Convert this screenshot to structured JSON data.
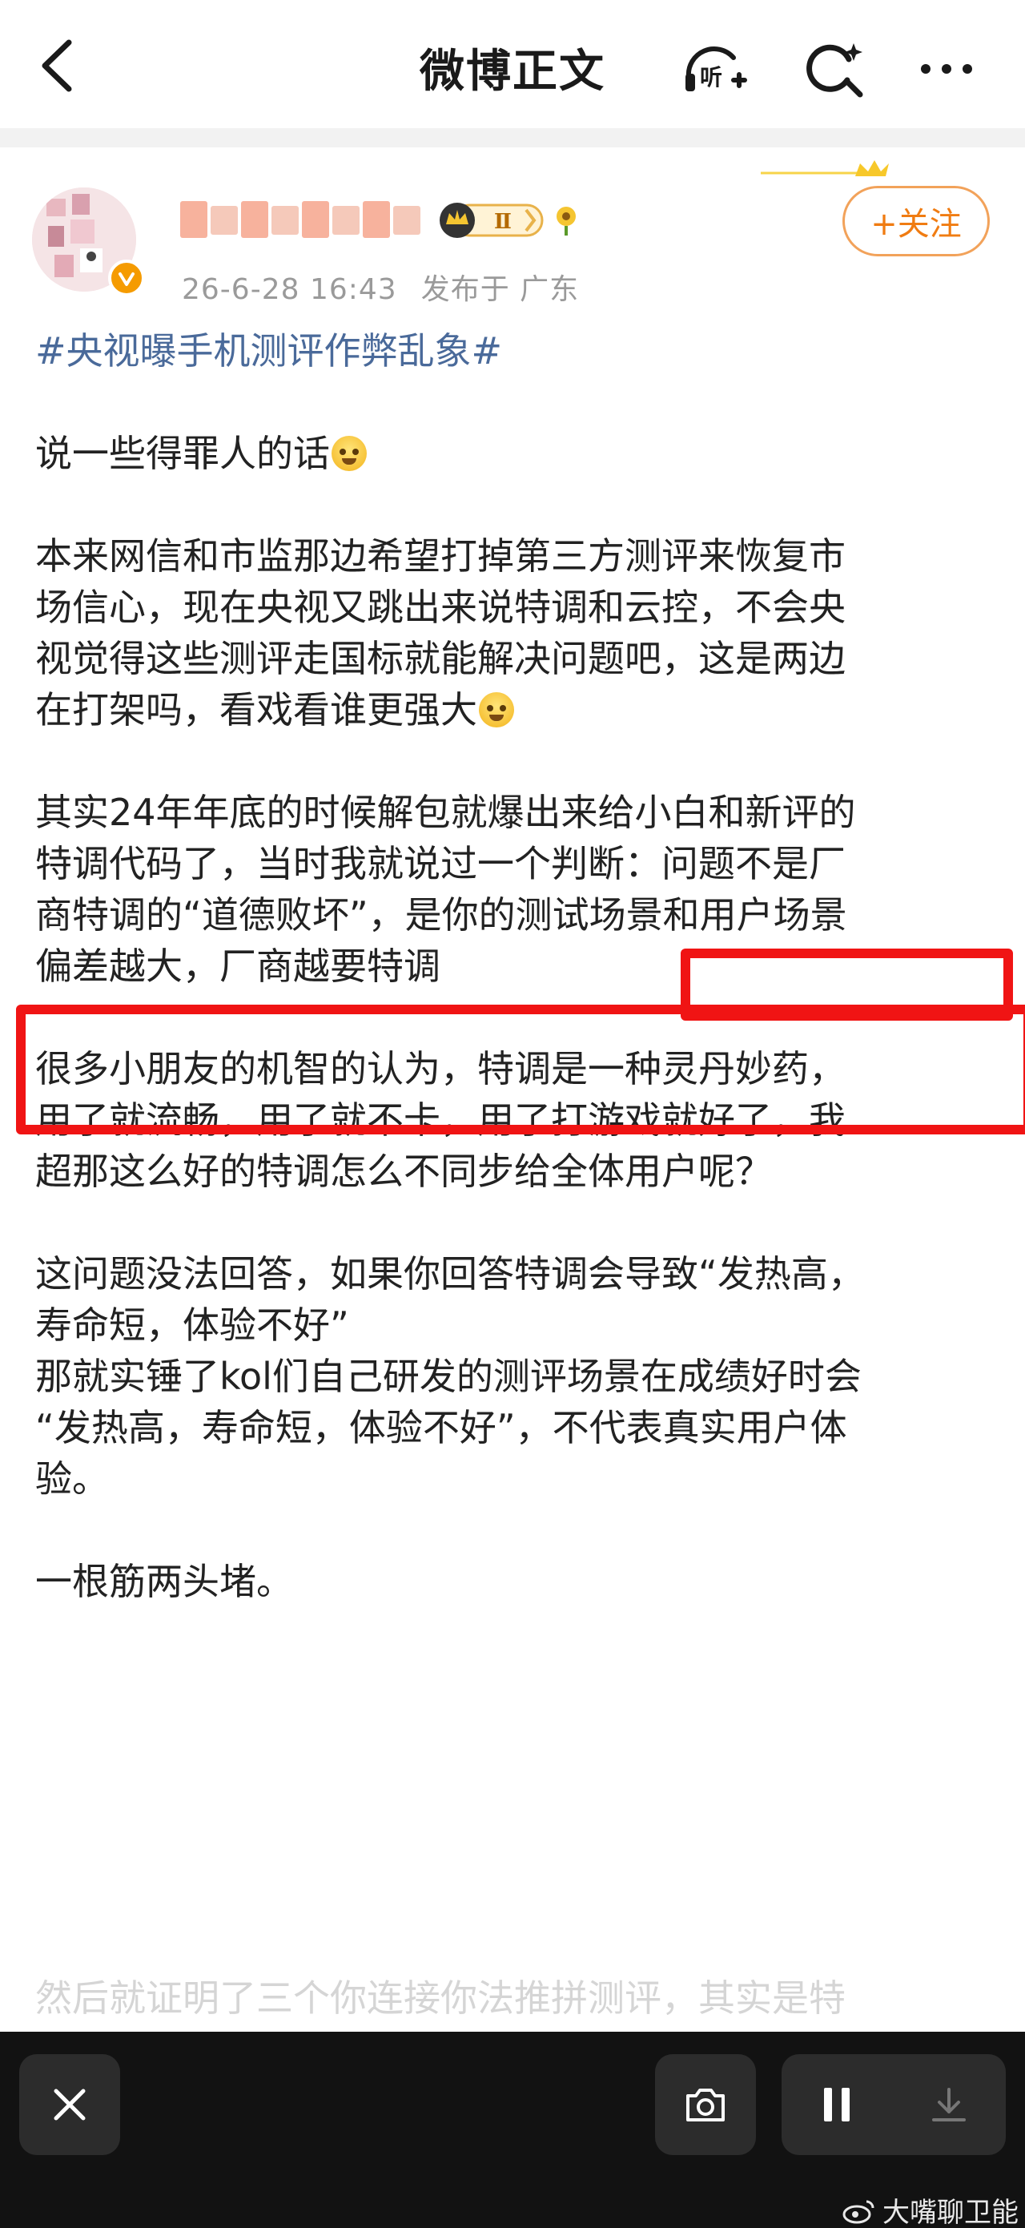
{
  "header": {
    "title": "微博正文"
  },
  "author": {
    "post_time": "26-6-28 16:43",
    "location": "发布于 广东",
    "level_badge": "Ⅱ",
    "follow_label": "+关注"
  },
  "post": {
    "hashtag": "#央视曝手机测评作弊乱象#",
    "p1": "说一些得罪人的话",
    "p2_lines": [
      "本来网信和市监那边希望打掉第三方测评来恢复市",
      "场信心，现在央视又跳出来说特调和云控，不会央",
      "视觉得这些测评走国标就能解决问题吧，这是两边",
      "在打架吗，看戏看谁更强大"
    ],
    "p3_lines": [
      "其实24年年底的时候解包就爆出来给小白和新评的",
      "特调代码了，当时我就说过一个判断：问题不是厂",
      "商特调的“道德败坏”，是你的测试场景和用户场景",
      "偏差越大，厂商越要特调"
    ],
    "p4_lines": [
      "很多小朋友的机智的认为，特调是一种灵丹妙药，",
      "用了就流畅，用了就不卡，用了打游戏就好了，我",
      "超那这么好的特调怎么不同步给全体用户呢？"
    ],
    "p5_lines": [
      "这问题没法回答，如果你回答特调会导致“发热高，",
      "寿命短，体验不好”",
      "那就实锤了kol们自己研发的测评场景在成绩好时会",
      "“发热高，寿命短，体验不好”，不代表真实用户体",
      "验。"
    ],
    "p6": "一根筋两头堵。",
    "cut_line": "然后就证明了三个你连接你法推拼测评，其实是特"
  },
  "watermark": {
    "text": "大嘴聊卫能"
  },
  "colors": {
    "accent_orange": "#f07c12",
    "hashtag_blue": "#4a6a9a",
    "highlight_red": "#f01414"
  },
  "icons": [
    "back-arrow-icon",
    "listen-icon",
    "search-icon",
    "more-icon",
    "close-icon",
    "camera-icon",
    "pause-icon",
    "download-icon",
    "weibo-logo-icon"
  ]
}
